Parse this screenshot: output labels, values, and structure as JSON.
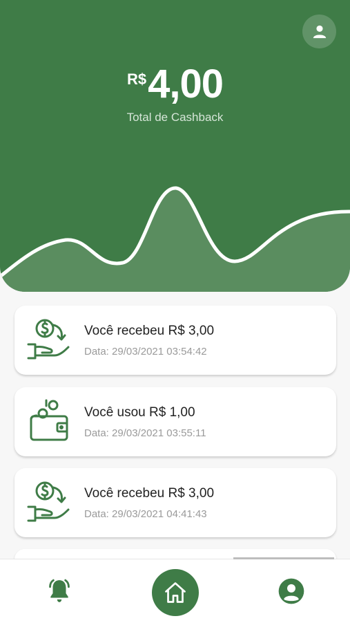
{
  "header": {
    "currency": "R$",
    "amount": "4,00",
    "label": "Total de Cashback"
  },
  "transactions": [
    {
      "title": "Você recebeu R$ 3,00",
      "date": "Data: 29/03/2021 03:54:42",
      "icon": "cashback-received-icon"
    },
    {
      "title": "Você usou R$ 1,00",
      "date": "Data: 29/03/2021 03:55:11",
      "icon": "wallet-coins-icon"
    },
    {
      "title": "Você recebeu R$ 3,00",
      "date": "Data: 29/03/2021 04:41:43",
      "icon": "cashback-received-icon"
    }
  ],
  "nav": {
    "items": [
      "bell-icon",
      "home-icon",
      "account-icon"
    ],
    "active": "home-icon"
  },
  "colors": {
    "primary": "#3f7c47",
    "wave_fill": "#5a8d5f",
    "muted_text": "#9a9a9a"
  }
}
